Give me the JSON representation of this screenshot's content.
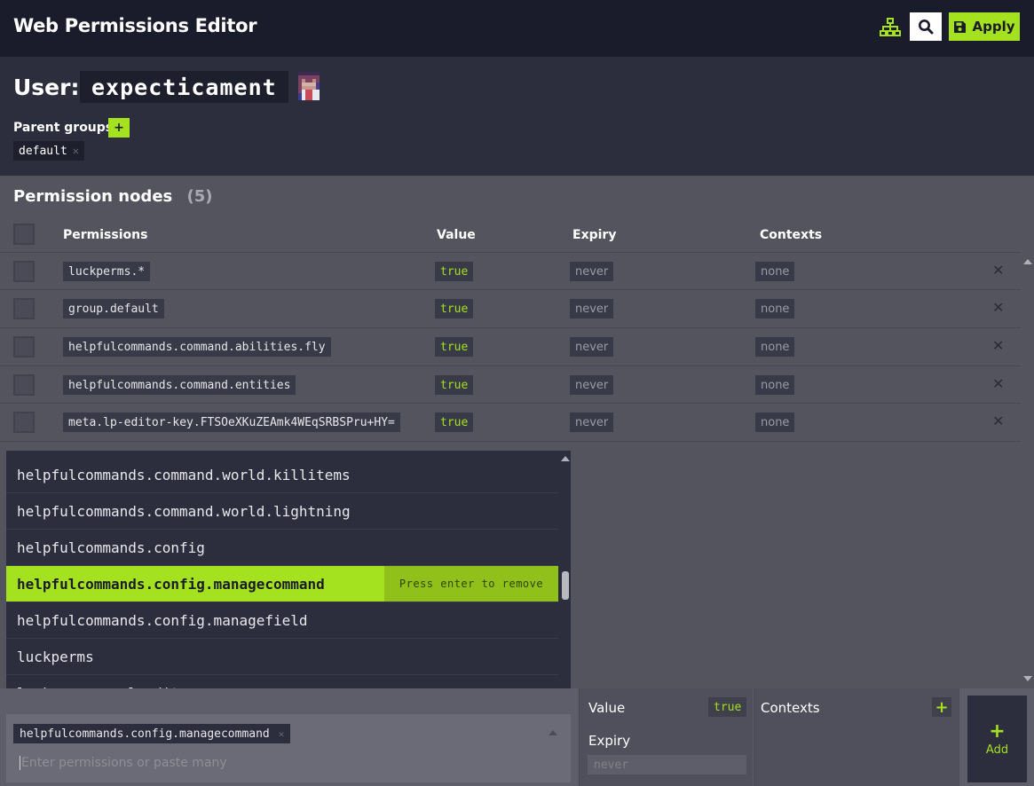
{
  "app": {
    "title": "Web Permissions Editor",
    "apply_label": "Apply",
    "accent": "#a4e11f",
    "icons": {
      "tree": "sitemap-icon",
      "search": "search-icon",
      "save": "floppy-disk-icon"
    }
  },
  "user": {
    "label": "User:",
    "name": "expecticament",
    "parent_groups_label": "Parent groups",
    "add_group_label": "+",
    "groups": [
      "default"
    ]
  },
  "permissions": {
    "title": "Permission nodes",
    "count": "(5)",
    "headers": {
      "permission": "Permissions",
      "value": "Value",
      "expiry": "Expiry",
      "contexts": "Contexts"
    },
    "rows": [
      {
        "node": "luckperms.*",
        "value": "true",
        "expiry": "never",
        "contexts": "none"
      },
      {
        "node": "group.default",
        "value": "true",
        "expiry": "never",
        "contexts": "none"
      },
      {
        "node": "helpfulcommands.command.abilities.fly",
        "value": "true",
        "expiry": "never",
        "contexts": "none"
      },
      {
        "node": "helpfulcommands.command.entities",
        "value": "true",
        "expiry": "never",
        "contexts": "none"
      },
      {
        "node": "meta.lp-editor-key.FTSOeXKuZEAmk4WEqSRBSPru+HY=",
        "value": "true",
        "expiry": "never",
        "contexts": "none"
      }
    ]
  },
  "dropdown": {
    "items": [
      "helpfulcommands.command.world.killitems",
      "helpfulcommands.command.world.lightning",
      "helpfulcommands.config",
      "helpfulcommands.config.managecommand",
      "helpfulcommands.config.managefield",
      "luckperms",
      "luckperms.applyedits"
    ],
    "active_index": 3,
    "active_hint": "Press enter to remove"
  },
  "add_panel": {
    "selected_chip": "helpfulcommands.config.managecommand",
    "placeholder": "Enter permissions or paste many",
    "value_label": "Value",
    "value": "true",
    "expiry_label": "Expiry",
    "expiry_placeholder": "never",
    "contexts_label": "Contexts",
    "contexts_add": "+",
    "add_plus": "+",
    "add_label": "Add"
  }
}
